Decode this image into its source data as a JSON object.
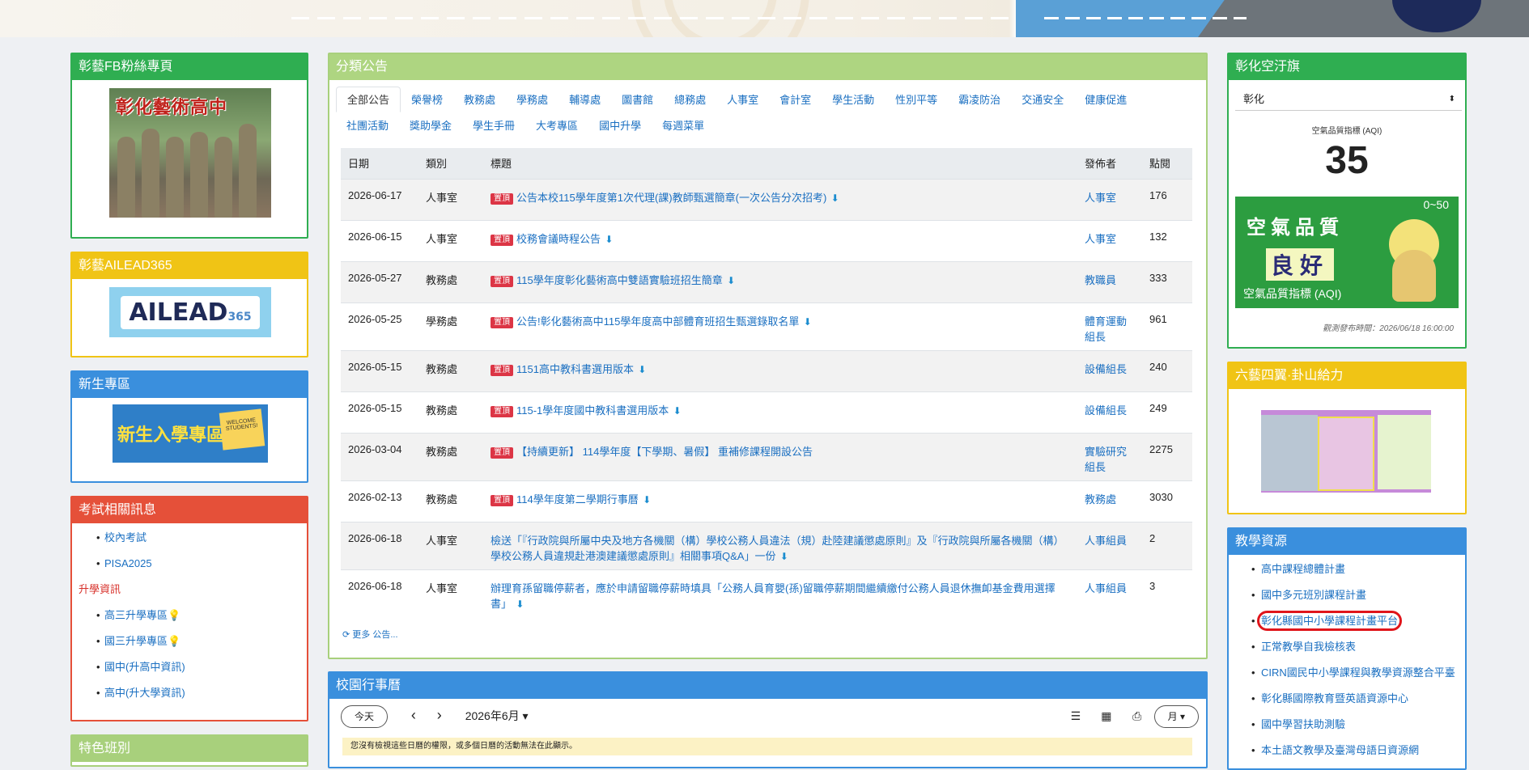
{
  "left": {
    "fb": {
      "title": "彰藝FB粉絲專頁",
      "sign": "彰化藝術高中"
    },
    "ailead": {
      "title": "彰藝AILEAD365",
      "logo_main": "AILEAD",
      "logo_sub": "365"
    },
    "freshman": {
      "title": "新生專區",
      "banner_text": "新生入學專區",
      "card_text": "WELCOME STUDENTS!"
    },
    "exam": {
      "title": "考試相關訊息",
      "items": [
        "校內考試",
        "PISA2025"
      ],
      "sub_title": "升學資訊",
      "sub_items": [
        "高三升學專區💡",
        "國三升學專區💡",
        "國中(升高中資訊)",
        "高中(升大學資訊)"
      ]
    },
    "special": {
      "title": "特色班別"
    }
  },
  "main": {
    "title": "分類公告",
    "tabs": [
      "全部公告",
      "榮譽榜",
      "教務處",
      "學務處",
      "輔導處",
      "圖書館",
      "總務處",
      "人事室",
      "會計室",
      "學生活動",
      "性別平等",
      "霸凌防治",
      "交通安全",
      "健康促進",
      "社團活動",
      "獎助學金",
      "學生手冊",
      "大考專區",
      "國中升學",
      "每週菜單"
    ],
    "columns": [
      "日期",
      "類別",
      "標題",
      "發佈者",
      "點閱"
    ],
    "pin_label": "置頂",
    "rows": [
      {
        "date": "2026-06-17",
        "cat": "人事室",
        "title": "公告本校115學年度第1次代理(課)教師甄選簡章(一次公告分次招考)",
        "pub": "人事室",
        "views": "176",
        "pinned": true,
        "dl": true
      },
      {
        "date": "2026-06-15",
        "cat": "人事室",
        "title": "校務會議時程公告",
        "pub": "人事室",
        "views": "132",
        "pinned": true,
        "dl": true
      },
      {
        "date": "2026-05-27",
        "cat": "教務處",
        "title": "115學年度彰化藝術高中雙語實驗班招生簡章",
        "pub": "教職員",
        "views": "333",
        "pinned": true,
        "dl": true
      },
      {
        "date": "2026-05-25",
        "cat": "學務處",
        "title": "公告!彰化藝術高中115學年度高中部體育班招生甄選錄取名單",
        "pub": "體育運動組長",
        "views": "961",
        "pinned": true,
        "dl": true
      },
      {
        "date": "2026-05-15",
        "cat": "教務處",
        "title": "1151高中教科書選用版本",
        "pub": "設備組長",
        "views": "240",
        "pinned": true,
        "dl": true
      },
      {
        "date": "2026-05-15",
        "cat": "教務處",
        "title": "115-1學年度國中教科書選用版本",
        "pub": "設備組長",
        "views": "249",
        "pinned": true,
        "dl": true
      },
      {
        "date": "2026-03-04",
        "cat": "教務處",
        "title": "【持續更新】 114學年度【下學期、暑假】 重補修課程開設公告",
        "pub": "實驗研究組長",
        "views": "2275",
        "pinned": true,
        "dl": false
      },
      {
        "date": "2026-02-13",
        "cat": "教務處",
        "title": "114學年度第二學期行事曆",
        "pub": "教務處",
        "views": "3030",
        "pinned": true,
        "dl": true
      },
      {
        "date": "2026-06-18",
        "cat": "人事室",
        "title": "檢送「『行政院與所屬中央及地方各機關（構）學校公務人員違法（規）赴陸建議懲處原則』及『行政院與所屬各機關（構）學校公務人員違規赴港澳建議懲處原則』相關事項Q&A」一份",
        "pub": "人事組員",
        "views": "2",
        "pinned": false,
        "dl": true
      },
      {
        "date": "2026-06-18",
        "cat": "人事室",
        "title": "辦理育孫留職停薪者，應於申請留職停薪時填具「公務人員育嬰(孫)留職停薪期間繼續繳付公務人員退休撫卹基金費用選擇書」",
        "pub": "人事組員",
        "views": "3",
        "pinned": false,
        "dl": true
      }
    ],
    "more": "更多 公告..."
  },
  "calendar": {
    "title": "校園行事曆",
    "today": "今天",
    "prev": "‹",
    "next": "›",
    "month": "2026年6月",
    "view": "月",
    "note": "您沒有檢視這些日曆的權限，或多個日曆的活動無法在此顯示。"
  },
  "right": {
    "air": {
      "title": "彰化空汙旗",
      "select": "彰化",
      "label": "空氣品質指標 (AQI)",
      "value": "35",
      "card_t1": "空氣品質",
      "card_t2": "良好",
      "card_t3": "空氣品質指標 (AQI)",
      "card_range": "0~50",
      "time": "觀測發布時間：2026/06/18 16:00:00"
    },
    "six": {
      "title": "六藝四翼·卦山給力"
    },
    "res": {
      "title": "教學資源",
      "items": [
        "高中課程總體計畫",
        "國中多元班別課程計畫",
        "彰化縣國中小學課程計畫平台",
        "正常教學自我檢核表",
        "CIRN國民中小學課程與教學資源整合平臺",
        "彰化縣國際教育暨英語資源中心",
        "國中學習扶助測驗",
        "本土語文教學及臺灣母語日資源網"
      ]
    }
  },
  "colors": {
    "green": "#2fae51",
    "yellow": "#f0c415",
    "blue": "#3a8fdd",
    "red": "#e55039",
    "light_green": "#aed581",
    "link": "#1a6fc1",
    "pin": "#dc3545"
  }
}
